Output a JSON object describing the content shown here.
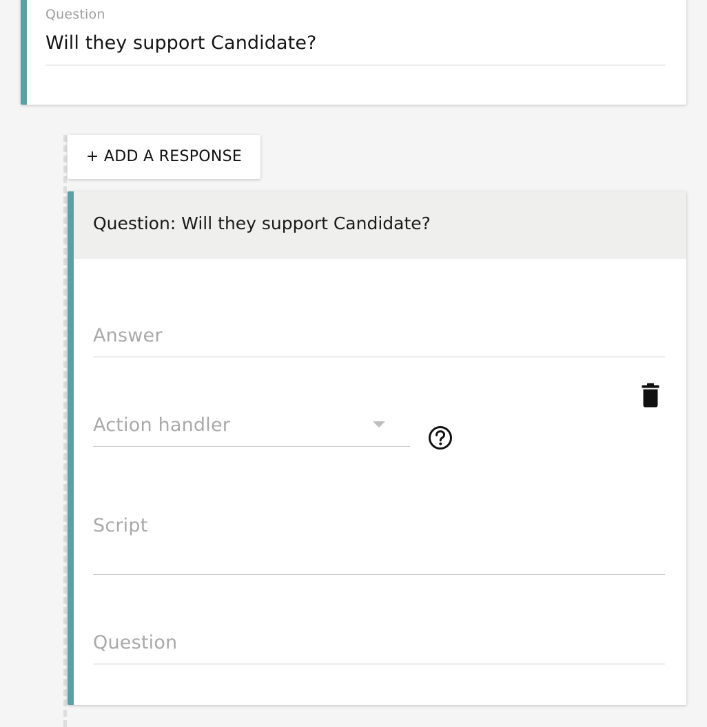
{
  "top_card": {
    "label": "Question",
    "value": "Will they support Candidate?"
  },
  "add_response": {
    "label": "+ ADD A RESPONSE"
  },
  "response_card": {
    "header_title": "Question: Will they support Candidate?",
    "answer_placeholder": "Answer",
    "action_handler_placeholder": "Action handler",
    "script_placeholder": "Script",
    "question_placeholder": "Question"
  },
  "icons": {
    "help": "help-circle-icon",
    "delete": "trash-icon",
    "dropdown": "caret-down-icon"
  },
  "colors": {
    "accent": "#5f9ea3",
    "header_bg": "#eff0ee",
    "page_bg": "#f5f5f5",
    "placeholder": "#a9a9a9"
  }
}
